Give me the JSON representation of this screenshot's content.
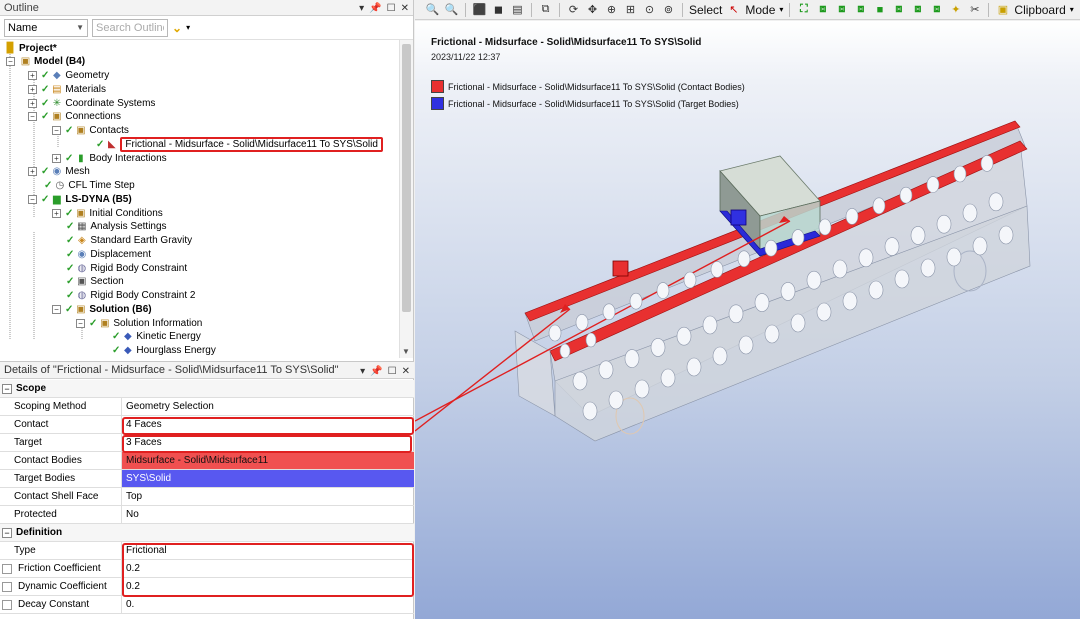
{
  "outline": {
    "title": "Outline",
    "name_dropdown": "Name",
    "search_placeholder": "Search Outline",
    "tree": [
      {
        "label": "Project*",
        "bold": true
      },
      {
        "label": "Model (B4)",
        "bold": true
      },
      {
        "label": "Geometry"
      },
      {
        "label": "Materials"
      },
      {
        "label": "Coordinate Systems"
      },
      {
        "label": "Connections"
      },
      {
        "label": "Contacts"
      },
      {
        "label": "Frictional - Midsurface - Solid\\Midsurface11 To SYS\\Solid"
      },
      {
        "label": "Body Interactions"
      },
      {
        "label": "Mesh"
      },
      {
        "label": "CFL Time Step"
      },
      {
        "label": "LS-DYNA (B5)",
        "bold": true
      },
      {
        "label": "Initial Conditions"
      },
      {
        "label": "Analysis Settings"
      },
      {
        "label": "Standard Earth Gravity"
      },
      {
        "label": "Displacement"
      },
      {
        "label": "Rigid Body Constraint"
      },
      {
        "label": "Section"
      },
      {
        "label": "Rigid Body Constraint 2"
      },
      {
        "label": "Solution (B6)",
        "bold": true
      },
      {
        "label": "Solution Information"
      },
      {
        "label": "Kinetic Energy"
      },
      {
        "label": "Hourglass Energy"
      }
    ]
  },
  "details": {
    "title": "Details of \"Frictional - Midsurface - Solid\\Midsurface11 To SYS\\Solid\"",
    "sections": [
      {
        "name": "Scope",
        "rows": [
          {
            "key": "Scoping Method",
            "value": "Geometry Selection"
          },
          {
            "key": "Contact",
            "value": "4 Faces"
          },
          {
            "key": "Target",
            "value": "3 Faces"
          },
          {
            "key": "Contact Bodies",
            "value": "Midsurface - Solid\\Midsurface11"
          },
          {
            "key": "Target Bodies",
            "value": "SYS\\Solid"
          },
          {
            "key": "Contact Shell Face",
            "value": "Top"
          },
          {
            "key": "Protected",
            "value": "No"
          }
        ]
      },
      {
        "name": "Definition",
        "rows": [
          {
            "key": "Type",
            "value": "Frictional"
          },
          {
            "key": "Friction Coefficient",
            "value": "0.2"
          },
          {
            "key": "Dynamic Coefficient",
            "value": "0.2"
          },
          {
            "key": "Decay Constant",
            "value": "0."
          }
        ]
      }
    ]
  },
  "toolbar": {
    "select_label": "Select",
    "mode_label": "Mode",
    "clipboard_label": "Clipboard"
  },
  "viewport": {
    "title": "Frictional - Midsurface - Solid\\Midsurface11 To SYS\\Solid",
    "date": "2023/11/22 12:37",
    "legend": [
      {
        "label": "Frictional - Midsurface - Solid\\Midsurface11 To SYS\\Solid (Contact Bodies)",
        "color": "#e83030"
      },
      {
        "label": "Frictional - Midsurface - Solid\\Midsurface11 To SYS\\Solid (Target Bodies)",
        "color": "#3030e0"
      }
    ]
  },
  "colors": {
    "contact": "#e83030",
    "target": "#3030e0",
    "highlight": "#e02020",
    "check": "#2a9d2a"
  }
}
